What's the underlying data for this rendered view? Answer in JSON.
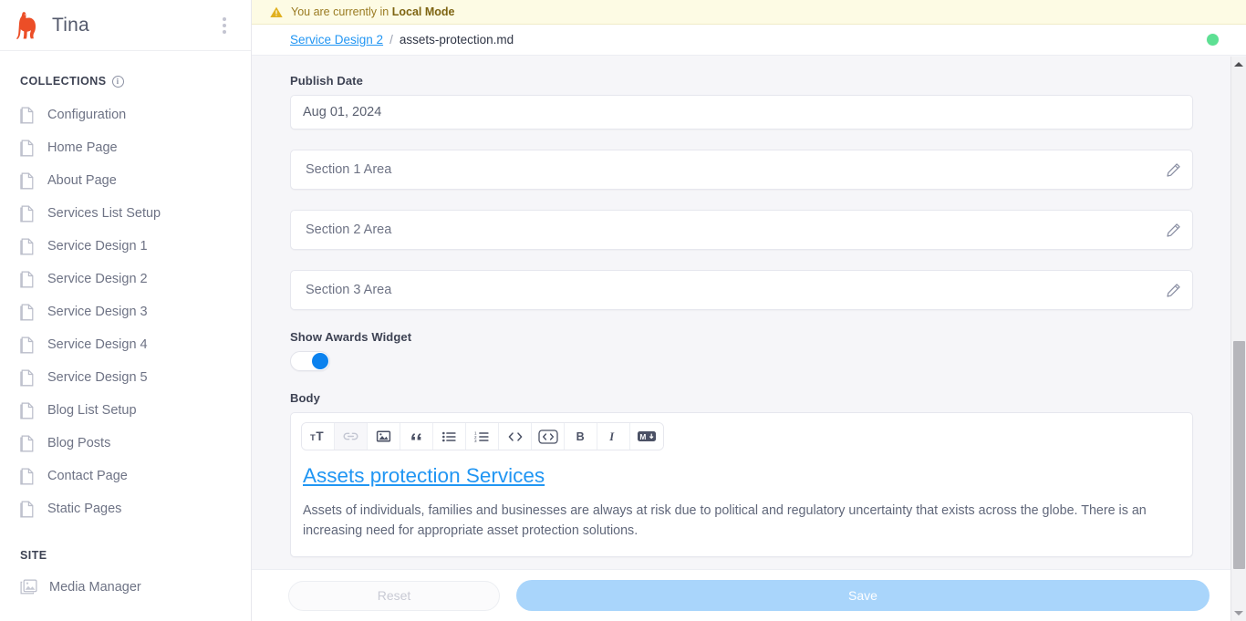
{
  "sidebar": {
    "brand_name": "Tina",
    "brand_icon": "llama-logo",
    "menu_icon": "kebab-menu-icon",
    "collections_title": "COLLECTIONS",
    "collections_info_icon": "info-icon",
    "collections": [
      {
        "label": "Configuration",
        "icon": "document-icon"
      },
      {
        "label": "Home Page",
        "icon": "document-icon"
      },
      {
        "label": "About Page",
        "icon": "document-icon"
      },
      {
        "label": "Services List Setup",
        "icon": "document-icon"
      },
      {
        "label": "Service Design 1",
        "icon": "document-icon"
      },
      {
        "label": "Service Design 2",
        "icon": "document-icon"
      },
      {
        "label": "Service Design 3",
        "icon": "document-icon"
      },
      {
        "label": "Service Design 4",
        "icon": "document-icon"
      },
      {
        "label": "Service Design 5",
        "icon": "document-icon"
      },
      {
        "label": "Blog List Setup",
        "icon": "document-icon"
      },
      {
        "label": "Blog Posts",
        "icon": "document-icon"
      },
      {
        "label": "Contact Page",
        "icon": "document-icon"
      },
      {
        "label": "Static Pages",
        "icon": "document-icon"
      }
    ],
    "site_title": "SITE",
    "site_items": [
      {
        "label": "Media Manager",
        "icon": "media-image-icon"
      }
    ]
  },
  "banner": {
    "icon": "warning-triangle-icon",
    "text_prefix": "You are currently in ",
    "mode": "Local Mode"
  },
  "breadcrumb": {
    "parent": "Service Design 2",
    "separator": "/",
    "current": "assets-protection.md",
    "status_icon": "status-dot-green",
    "status_color": "#5de093"
  },
  "form": {
    "publish_date": {
      "label": "Publish Date",
      "value": "Aug 01, 2024"
    },
    "sections": [
      {
        "label": "Section 1 Area",
        "icon": "pencil-icon"
      },
      {
        "label": "Section 2 Area",
        "icon": "pencil-icon"
      },
      {
        "label": "Section 3 Area",
        "icon": "pencil-icon"
      }
    ],
    "awards_toggle": {
      "label": "Show Awards Widget",
      "state": "on",
      "accent_color": "#0c82ee"
    },
    "body": {
      "label": "Body",
      "toolbar": [
        {
          "name": "heading-icon",
          "title": "Heading",
          "disabled": false
        },
        {
          "name": "link-icon",
          "title": "Link",
          "disabled": true
        },
        {
          "name": "image-icon",
          "title": "Image",
          "disabled": false
        },
        {
          "name": "quote-icon",
          "title": "Quote",
          "disabled": false
        },
        {
          "name": "bulleted-list-icon",
          "title": "Bulleted list",
          "disabled": false
        },
        {
          "name": "numbered-list-icon",
          "title": "Numbered list",
          "disabled": false
        },
        {
          "name": "inline-code-icon",
          "title": "Inline code",
          "disabled": false
        },
        {
          "name": "code-block-icon",
          "title": "Code block",
          "disabled": false
        },
        {
          "name": "bold-icon",
          "title": "Bold",
          "disabled": false
        },
        {
          "name": "italic-icon",
          "title": "Italic",
          "disabled": false
        },
        {
          "name": "markdown-icon",
          "title": "Raw markdown",
          "disabled": false
        }
      ],
      "heading": "Assets protection Services",
      "heading_color": "#2196f3",
      "paragraph": "Assets of individuals, families and businesses are always at risk due to political and regulatory uncertainty that exists across the globe. There is an increasing need for appropriate asset protection solutions."
    }
  },
  "footer": {
    "reset_label": "Reset",
    "save_label": "Save",
    "save_color": "#a9d5fb"
  },
  "scrollbar": {
    "up_icon": "scroll-up-arrow-icon",
    "down_icon": "scroll-down-arrow-icon"
  }
}
